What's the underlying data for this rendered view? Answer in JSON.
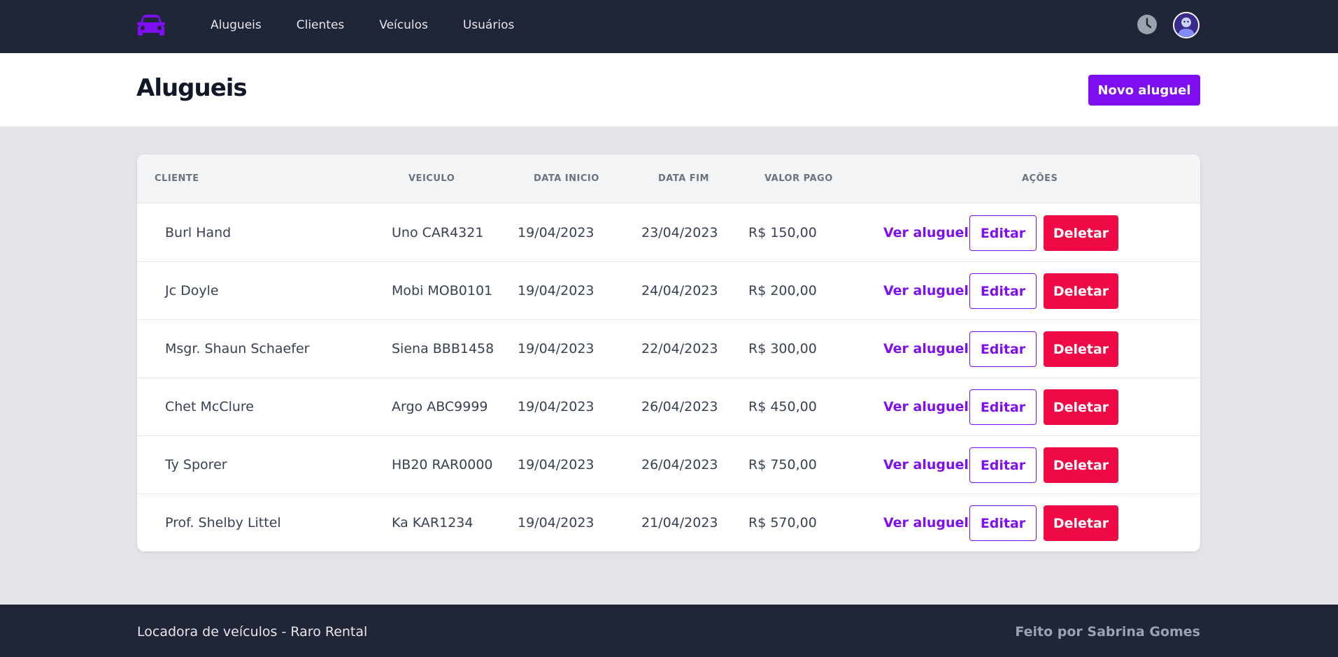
{
  "nav": {
    "links": [
      "Alugueis",
      "Clientes",
      "Veículos",
      "Usuários"
    ],
    "logo_icon": "car-icon",
    "history_icon": "clock-icon",
    "avatar_icon": "user-avatar"
  },
  "header": {
    "title": "Alugueis",
    "new_button": "Novo aluguel"
  },
  "table": {
    "columns": [
      "CLIENTE",
      "VEICULO",
      "DATA INICIO",
      "DATA FIM",
      "VALOR PAGO",
      "AÇÕES"
    ],
    "rows": [
      {
        "cliente": "Burl Hand",
        "veiculo": "Uno CAR4321",
        "inicio": "19/04/2023",
        "fim": "23/04/2023",
        "valor": "R$ 150,00"
      },
      {
        "cliente": "Jc Doyle",
        "veiculo": "Mobi MOB0101",
        "inicio": "19/04/2023",
        "fim": "24/04/2023",
        "valor": "R$ 200,00"
      },
      {
        "cliente": "Msgr. Shaun Schaefer",
        "veiculo": "Siena BBB1458",
        "inicio": "19/04/2023",
        "fim": "22/04/2023",
        "valor": "R$ 300,00"
      },
      {
        "cliente": "Chet McClure",
        "veiculo": "Argo ABC9999",
        "inicio": "19/04/2023",
        "fim": "26/04/2023",
        "valor": "R$ 450,00"
      },
      {
        "cliente": "Ty Sporer",
        "veiculo": "HB20 RAR0000",
        "inicio": "19/04/2023",
        "fim": "26/04/2023",
        "valor": "R$ 750,00"
      },
      {
        "cliente": "Prof. Shelby Littel",
        "veiculo": "Ka KAR1234",
        "inicio": "19/04/2023",
        "fim": "21/04/2023",
        "valor": "R$ 570,00"
      }
    ],
    "actions": {
      "view": "Ver aluguel",
      "edit": "Editar",
      "delete": "Deletar"
    }
  },
  "footer": {
    "left": "Locadora de veículos - Raro Rental",
    "right": "Feito por Sabrina Gomes"
  },
  "colors": {
    "nav_bg": "#202637",
    "accent": "#7e0ff0",
    "danger": "#f00a45",
    "page_bg": "#e4e4e8"
  }
}
